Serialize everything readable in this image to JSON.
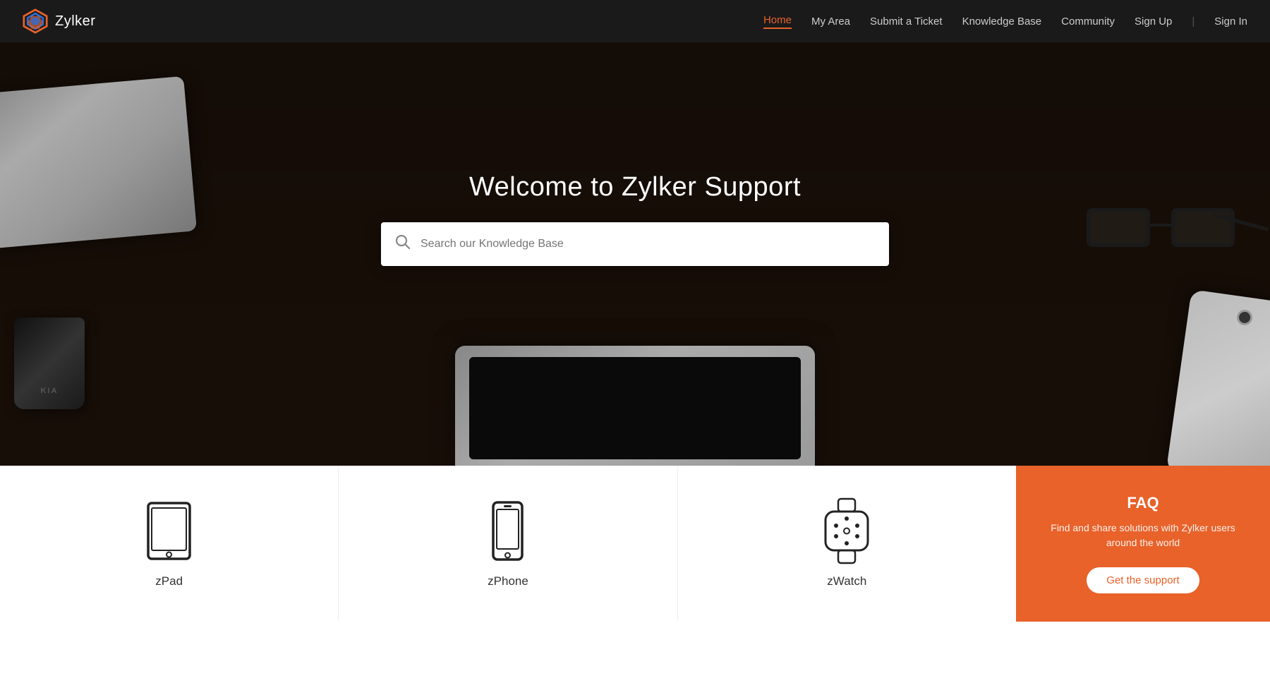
{
  "brand": {
    "name": "Zylker",
    "logo_alt": "Zylker logo"
  },
  "navbar": {
    "links": [
      {
        "id": "home",
        "label": "Home",
        "active": true
      },
      {
        "id": "my-area",
        "label": "My Area",
        "active": false
      },
      {
        "id": "submit-ticket",
        "label": "Submit a Ticket",
        "active": false
      },
      {
        "id": "knowledge-base",
        "label": "Knowledge Base",
        "active": false
      },
      {
        "id": "community",
        "label": "Community",
        "active": false
      }
    ],
    "signup_label": "Sign Up",
    "signin_label": "Sign In"
  },
  "hero": {
    "title": "Welcome to Zylker Support",
    "search_placeholder": "Search our Knowledge Base"
  },
  "products": [
    {
      "id": "zpad",
      "name": "zPad"
    },
    {
      "id": "zphone",
      "name": "zPhone"
    },
    {
      "id": "zwatch",
      "name": "zWatch"
    }
  ],
  "faq": {
    "title": "FAQ",
    "description": "Find and share solutions with Zylker users around the world",
    "button_label": "Get the support"
  },
  "colors": {
    "accent": "#e8622a",
    "nav_bg": "#1a1a1a",
    "hero_overlay": "rgba(0,0,0,0.5)"
  }
}
